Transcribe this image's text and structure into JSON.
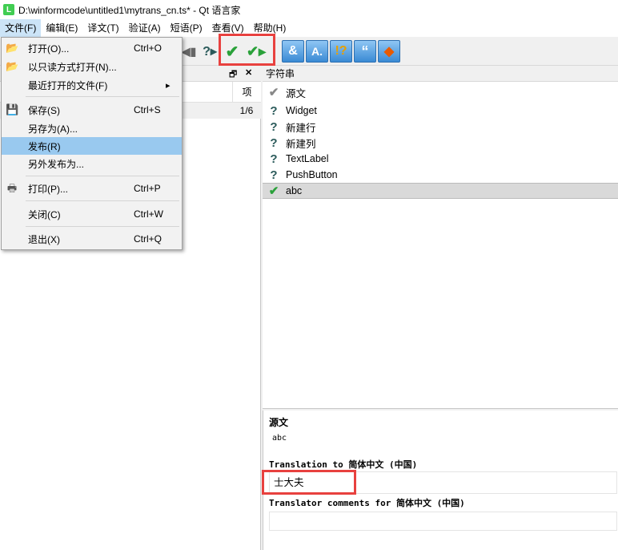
{
  "window": {
    "title": "D:\\winformcode\\untitled1\\mytrans_cn.ts* - Qt 语言家",
    "logo": "L"
  },
  "menubar": [
    "文件(F)",
    "编辑(E)",
    "译文(T)",
    "验证(A)",
    "短语(P)",
    "查看(V)",
    "帮助(H)"
  ],
  "file_menu": {
    "items": [
      {
        "label": "打开(O)...",
        "shortcut": "Ctrl+O",
        "icon": "folder-icon"
      },
      {
        "label": "以只读方式打开(N)...",
        "shortcut": "",
        "icon": "folder-icon"
      },
      {
        "label": "最近打开的文件(F)",
        "shortcut": "",
        "icon": "",
        "submenu": true
      },
      {
        "label": "保存(S)",
        "shortcut": "Ctrl+S",
        "icon": "save-icon"
      },
      {
        "label": "另存为(A)...",
        "shortcut": "",
        "icon": ""
      },
      {
        "label": "发布(R)",
        "shortcut": "",
        "icon": "",
        "highlighted": true
      },
      {
        "label": "另外发布为...",
        "shortcut": "",
        "icon": ""
      },
      {
        "label": "打印(P)...",
        "shortcut": "Ctrl+P",
        "icon": "printer-icon"
      },
      {
        "label": "关闭(C)",
        "shortcut": "Ctrl+W",
        "icon": ""
      },
      {
        "label": "退出(X)",
        "shortcut": "Ctrl+Q",
        "icon": ""
      }
    ],
    "submenu_arrow": "▸"
  },
  "context_panel": {
    "col_item": "项",
    "row_count": "1/6",
    "float_glyph": "🗗",
    "close_glyph": "✕"
  },
  "strings_panel": {
    "header": "字符串",
    "source_col": "源文",
    "rows": [
      {
        "label": "Widget",
        "status": "unfinished"
      },
      {
        "label": "新建行",
        "status": "unfinished"
      },
      {
        "label": "新建列",
        "status": "unfinished"
      },
      {
        "label": "TextLabel",
        "status": "unfinished"
      },
      {
        "label": "PushButton",
        "status": "unfinished"
      },
      {
        "label": "abc",
        "status": "done",
        "selected": true
      }
    ]
  },
  "editor": {
    "source_label": "源文",
    "source_text": "abc",
    "translation_label": "Translation to 简体中文 (中国)",
    "translation_value": "士大夫",
    "comments_label": "Translator comments for 简体中文 (中国)",
    "comments_value": ""
  },
  "colors": {
    "highlight": "#99c9ef",
    "annotation_red": "#e8413f",
    "done_green": "#2aa13a"
  }
}
